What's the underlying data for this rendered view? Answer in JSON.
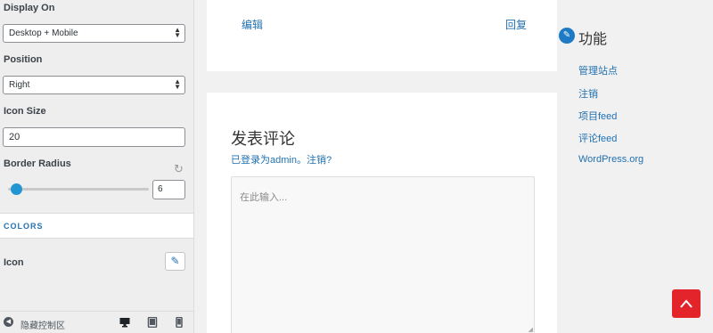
{
  "controls": {
    "display_on": {
      "label": "Display On",
      "value": "Desktop + Mobile"
    },
    "position": {
      "label": "Position",
      "value": "Right"
    },
    "icon_size": {
      "label": "Icon Size",
      "value": "20"
    },
    "border_radius": {
      "label": "Border Radius",
      "value": "6",
      "slider_fraction": 0.06
    },
    "colors_heading": "COLORS",
    "icon_color_label": "Icon"
  },
  "footer": {
    "collapse_label": "隐藏控制区",
    "icons": [
      "desktop-icon",
      "tablet-icon",
      "mobile-icon"
    ]
  },
  "preview": {
    "edit_link": "编辑",
    "reply_link": "回复",
    "reply_title": "发表评论",
    "logged_in_text": "已登录为admin。注销?",
    "comment_placeholder": "在此输入...",
    "widget_title": "功能",
    "meta_links": [
      "管理站点",
      "注销",
      "项目feed",
      "评论feed",
      "WordPress.org"
    ]
  },
  "colors": {
    "accent": "#2271b1",
    "slider": "#2196d3",
    "scroll_top": "#e3242b"
  }
}
